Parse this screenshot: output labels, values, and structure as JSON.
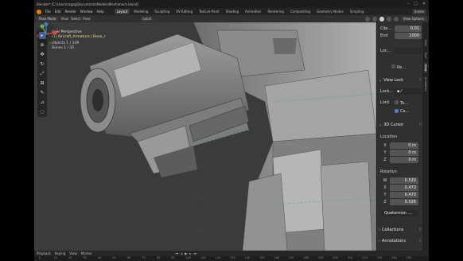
{
  "window": {
    "title": "Blender* [C:\\Users\\ragog\\Documents\\Models\\Mech\\mech.blend]",
    "controls": [
      "–",
      "□",
      "✕"
    ]
  },
  "menu": {
    "items": [
      "File",
      "Edit",
      "Render",
      "Window",
      "Help"
    ],
    "workspaces": [
      "Layout",
      "Modeling",
      "Sculpting",
      "UV Editing",
      "Texture Paint",
      "Shading",
      "Animation",
      "Rendering",
      "Compositing",
      "Geometry Nodes",
      "Scripting"
    ],
    "active_workspace": "Layout",
    "scene": "Scene"
  },
  "header3d": {
    "mode": "Pose Mode",
    "items": [
      "View",
      "Select",
      "Pose"
    ],
    "orientation": "Local",
    "view_options": "View Options"
  },
  "viewport": {
    "title": "User Perspective",
    "subtitle": "(1) Aircraft_Armature | Bone_r",
    "objects": "Objects   1 / 149",
    "bones": "Bones     1 / 35"
  },
  "npanel": {
    "clip_start_label": "Clip...",
    "clip_start": "0.01",
    "clip_end_label": "End",
    "clip_end": "1000",
    "local_camera_label": "Loc...",
    "render_region_label": "Re...",
    "view_lock_title": "View Lock",
    "lock_obj_label": "Lock...",
    "lock_to_label": "Lock",
    "lock_to_value": "To...",
    "lock_camera_label": "Ca...",
    "cursor_title": "3D Cursor",
    "location_label": "Location",
    "loc_x": "0 m",
    "loc_y": "0 m",
    "loc_z": "0 m",
    "rotation_label": "Rotation",
    "rot_w": "0.520",
    "rot_x": "0.473",
    "rot_y": "0.473",
    "rot_z": "0.526",
    "rotation_mode": "Quaternion ...",
    "collections_title": "Collections",
    "annotations_title": "Annotations",
    "tabs": [
      "Item",
      "Tool",
      "View",
      "Animation"
    ]
  },
  "timeline": {
    "items": [
      "Playback",
      "Keying",
      "View",
      "Marker"
    ],
    "ticks": [
      "0",
      "10",
      "20",
      "30",
      "40",
      "50",
      "60",
      "70",
      "80",
      "90",
      "100",
      "110",
      "120",
      "130",
      "140",
      "150",
      "160",
      "170",
      "180",
      "190",
      "200",
      "210",
      "220",
      "230",
      "240",
      "250"
    ]
  }
}
